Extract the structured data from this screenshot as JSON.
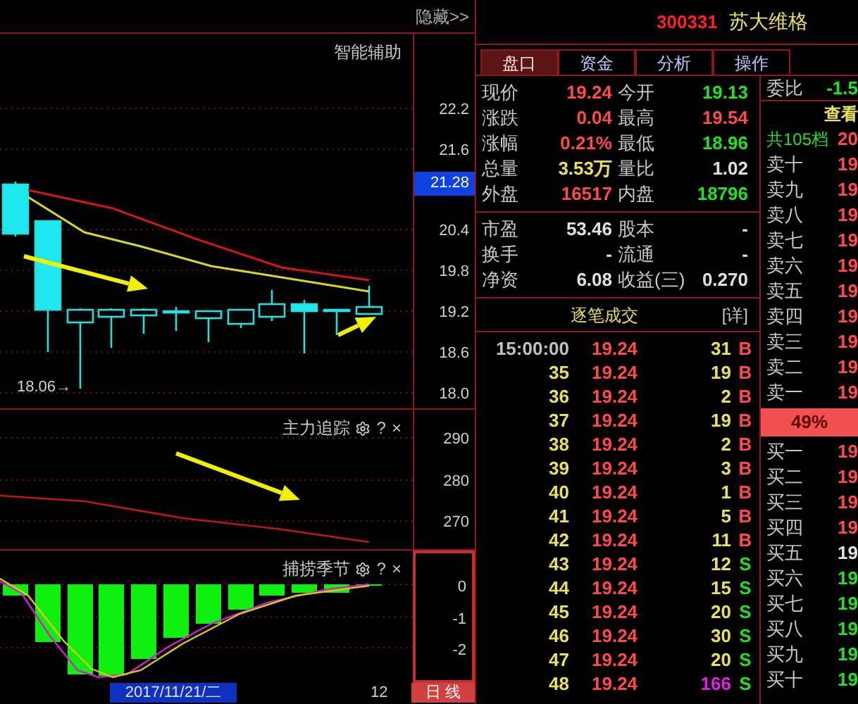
{
  "chart_panel": {
    "hide_button": "隐藏>>",
    "title": "智能辅助",
    "y_ticks": [
      "22.2",
      "21.6",
      "20.4",
      "19.8",
      "19.2",
      "18.6",
      "18.0"
    ],
    "current_price": "21.28",
    "low_marker": "18.06→"
  },
  "indicator_1": {
    "title": "主力追踪",
    "help": "?",
    "close": "×",
    "y_ticks": [
      "290",
      "280",
      "270"
    ]
  },
  "indicator_2": {
    "title": "捕捞季节",
    "help": "?",
    "close": "×",
    "y_ticks": [
      "0",
      "-1",
      "-2"
    ]
  },
  "bottom_bar": {
    "date": "2017/11/21/二",
    "count": "12",
    "period": "日 线"
  },
  "stock": {
    "code": "300331",
    "name": "苏大维格"
  },
  "tabs": [
    {
      "label": "盘口",
      "selected": true
    },
    {
      "label": "资金",
      "selected": false
    },
    {
      "label": "分析",
      "selected": false
    },
    {
      "label": "操作",
      "selected": false
    }
  ],
  "quote_rows": [
    [
      {
        "label": "现价",
        "value": "19.24",
        "color": "#ff4a4a"
      },
      {
        "label": "今开",
        "value": "19.13",
        "color": "#22e022"
      }
    ],
    [
      {
        "label": "涨跌",
        "value": "0.04",
        "color": "#ff4a4a"
      },
      {
        "label": "最高",
        "value": "19.54",
        "color": "#ff4a4a"
      }
    ],
    [
      {
        "label": "涨幅",
        "value": "0.21%",
        "color": "#ff4a4a"
      },
      {
        "label": "最低",
        "value": "18.96",
        "color": "#22e022"
      }
    ],
    [
      {
        "label": "总量",
        "value": "3.53万",
        "color": "#e8e060"
      },
      {
        "label": "量比",
        "value": "1.02",
        "color": "#e0e0e0"
      }
    ],
    [
      {
        "label": "外盘",
        "value": "16517",
        "color": "#ff4a4a"
      },
      {
        "label": "内盘",
        "value": "18796",
        "color": "#22e022"
      }
    ]
  ],
  "info_rows": [
    [
      {
        "label": "市盈",
        "value": "53.46"
      },
      {
        "label": "股本",
        "value": "-"
      }
    ],
    [
      {
        "label": "换手",
        "value": "-"
      },
      {
        "label": "流通",
        "value": "-"
      }
    ],
    [
      {
        "label": "净资",
        "value": "6.08"
      },
      {
        "label": "收益(三)",
        "value": "0.270"
      }
    ]
  ],
  "trades": {
    "title": "逐笔成交",
    "detail": "[详]",
    "rows": [
      {
        "time": "15:00:00",
        "kind": "full",
        "price": "19.24",
        "volume": "31",
        "side": "B",
        "large": false
      },
      {
        "time": "35",
        "kind": "second",
        "price": "19.24",
        "volume": "19",
        "side": "B",
        "large": false
      },
      {
        "time": "36",
        "kind": "second",
        "price": "19.24",
        "volume": "2",
        "side": "B",
        "large": false
      },
      {
        "time": "37",
        "kind": "second",
        "price": "19.24",
        "volume": "19",
        "side": "B",
        "large": false
      },
      {
        "time": "38",
        "kind": "second",
        "price": "19.24",
        "volume": "2",
        "side": "B",
        "large": false
      },
      {
        "time": "39",
        "kind": "second",
        "price": "19.24",
        "volume": "3",
        "side": "B",
        "large": false
      },
      {
        "time": "40",
        "kind": "second",
        "price": "19.24",
        "volume": "1",
        "side": "B",
        "large": false
      },
      {
        "time": "41",
        "kind": "second",
        "price": "19.24",
        "volume": "5",
        "side": "B",
        "large": false
      },
      {
        "time": "42",
        "kind": "second",
        "price": "19.24",
        "volume": "11",
        "side": "B",
        "large": false
      },
      {
        "time": "43",
        "kind": "second",
        "price": "19.24",
        "volume": "12",
        "side": "S",
        "large": false
      },
      {
        "time": "44",
        "kind": "second",
        "price": "19.24",
        "volume": "15",
        "side": "S",
        "large": false
      },
      {
        "time": "45",
        "kind": "second",
        "price": "19.24",
        "volume": "20",
        "side": "S",
        "large": false
      },
      {
        "time": "46",
        "kind": "second",
        "price": "19.24",
        "volume": "30",
        "side": "S",
        "large": false
      },
      {
        "time": "47",
        "kind": "second",
        "price": "19.24",
        "volume": "20",
        "side": "S",
        "large": false
      },
      {
        "time": "48",
        "kind": "second",
        "price": "19.24",
        "volume": "166",
        "side": "S",
        "large": true
      }
    ]
  },
  "order_book": {
    "ratio_label": "委比",
    "ratio_value": "-1.5",
    "view": "查看",
    "levels_label": "共105档",
    "levels_value": "20",
    "asks": [
      {
        "label": "卖十",
        "price": "19",
        "color": "#ff4a4a"
      },
      {
        "label": "卖九",
        "price": "19",
        "color": "#ff4a4a"
      },
      {
        "label": "卖八",
        "price": "19",
        "color": "#ff4a4a"
      },
      {
        "label": "卖七",
        "price": "19",
        "color": "#ff4a4a"
      },
      {
        "label": "卖六",
        "price": "19",
        "color": "#ff4a4a"
      },
      {
        "label": "卖五",
        "price": "19",
        "color": "#ff4a4a"
      },
      {
        "label": "卖四",
        "price": "19",
        "color": "#ff4a4a"
      },
      {
        "label": "卖三",
        "price": "19",
        "color": "#ff4a4a"
      },
      {
        "label": "卖二",
        "price": "19",
        "color": "#ff4a4a"
      },
      {
        "label": "卖一",
        "price": "19",
        "color": "#ff4a4a"
      }
    ],
    "buy_share": "49%",
    "bids": [
      {
        "label": "买一",
        "price": "19",
        "color": "#ff4a4a"
      },
      {
        "label": "买二",
        "price": "19",
        "color": "#ff4a4a"
      },
      {
        "label": "买三",
        "price": "19",
        "color": "#ff4a4a"
      },
      {
        "label": "买四",
        "price": "19",
        "color": "#ff4a4a"
      },
      {
        "label": "买五",
        "price": "19",
        "color": "#e0e0e0"
      },
      {
        "label": "买六",
        "price": "19",
        "color": "#22e022"
      },
      {
        "label": "买七",
        "price": "19",
        "color": "#22e022"
      },
      {
        "label": "买八",
        "price": "19",
        "color": "#22e022"
      },
      {
        "label": "买九",
        "price": "19",
        "color": "#22e022"
      },
      {
        "label": "买十",
        "price": "19",
        "color": "#22e022"
      }
    ]
  }
}
